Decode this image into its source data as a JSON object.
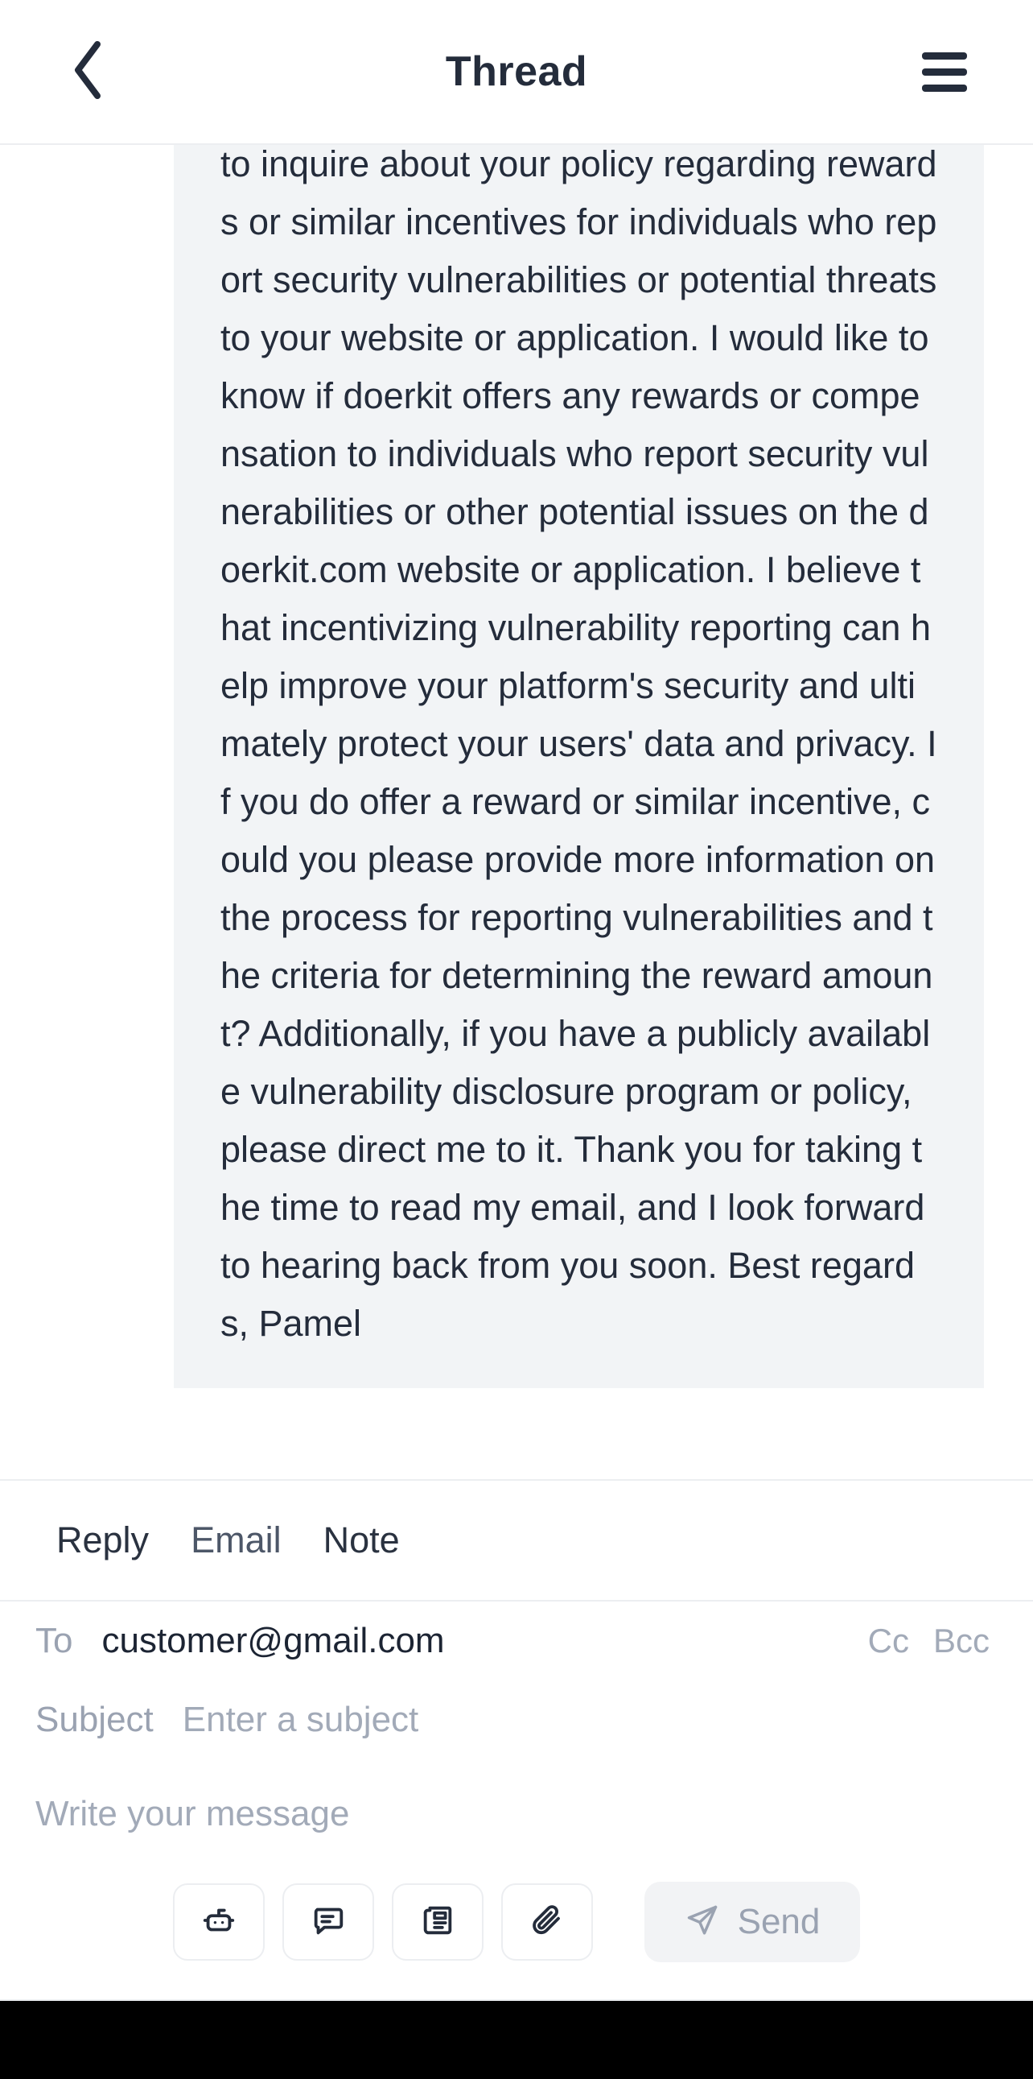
{
  "header": {
    "title": "Thread",
    "back_icon": "chevron-left-icon",
    "menu_icon": "hamburger-menu-icon"
  },
  "thread": {
    "message": {
      "body": "to inquire about your policy regarding rewards or similar incentives for individuals who report security vulnerabilities or potential threats to your website or application. I would like to know if doerkit offers any rewards or compensation to individuals who report security vulnerabilities or other potential issues on the doerkit.com website or application. I believe that incentivizing vulnerability reporting can help improve your platform's security and ultimately protect your users' data and privacy. If you do offer a reward or similar incentive, could you please provide more information on the process for reporting vulnerabilities and the criteria for determining the reward amount? Additionally, if you have a publicly available vulnerability disclosure program or policy, please direct me to it. Thank you for taking the time to read my email, and I look forward to hearing back from you soon. Best regards, Pamel"
    }
  },
  "tabs": [
    {
      "label": "Reply",
      "state": "active"
    },
    {
      "label": "Email",
      "state": "muted"
    },
    {
      "label": "Note",
      "state": "inactive"
    }
  ],
  "compose": {
    "to": {
      "label": "To",
      "value": "customer@gmail.com"
    },
    "cc_label": "Cc",
    "bcc_label": "Bcc",
    "subject": {
      "label": "Subject",
      "placeholder": "Enter a subject",
      "value": ""
    },
    "body": {
      "placeholder": "Write your message",
      "value": ""
    }
  },
  "toolbar": {
    "buttons": [
      {
        "icon": "robot-icon",
        "name": "ai-assist-button"
      },
      {
        "icon": "canned-response-icon",
        "name": "canned-response-button"
      },
      {
        "icon": "article-icon",
        "name": "knowledge-article-button"
      },
      {
        "icon": "paperclip-icon",
        "name": "attachment-button"
      }
    ],
    "send": {
      "label": "Send",
      "icon": "send-paper-plane-icon",
      "enabled": false
    }
  },
  "colors": {
    "text_dark": "#242c3b",
    "text_muted": "#9aa2b1",
    "bubble_bg": "#f2f4f6",
    "border": "#eceef1",
    "send_disabled_bg": "#f2f3f5",
    "safe_area": "#000000"
  }
}
